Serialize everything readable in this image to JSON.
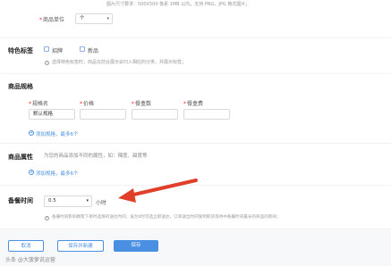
{
  "image_hint": "图片尺寸要求：500X500 像素 1MB 以内，支持 PNG、JPG 格式图片；",
  "unit": {
    "required_mark": "*",
    "label": "商品单位",
    "value": "个",
    "chevron": "chevron-down-icon"
  },
  "feature_tags": {
    "title": "特色标签",
    "options": [
      "招牌",
      "新品"
    ],
    "hint_icon": "info-icon",
    "hint": "选择特色标签时，商品在前台展示会归入相应的分类，并展示标签；"
  },
  "spec": {
    "title": "商品规格",
    "headers": [
      "规格名",
      "价格",
      "餐盒数",
      "餐盒费"
    ],
    "required_mark": "*",
    "values": [
      "默认规格",
      "",
      "",
      ""
    ],
    "add_label": "添加规格，最多6个",
    "add_icon": "plus-circle-icon"
  },
  "attributes": {
    "title": "商品属性",
    "hint": "为您的商品添加不同的属性，如：辣度、甜度等",
    "add_label": "添加规格，最多6个",
    "add_icon": "plus-circle-icon"
  },
  "prep_time": {
    "title": "备餐时间",
    "value": "0.5",
    "unit": "小时",
    "hint_icon": "info-icon",
    "hint": "备餐时间影响顾客下单时选择的送达时间，设为0时可选立即送达，订单送出时间受到取货等待中备餐时间最长的商品的影响；"
  },
  "footer": {
    "cancel": "取消",
    "save_new": "保存并新建",
    "save": "保存"
  },
  "watermark": "头条 @大菠萝说运营",
  "colors": {
    "primary": "#4a90e2",
    "arrow": "#e0402a",
    "required": "#f5222d"
  }
}
